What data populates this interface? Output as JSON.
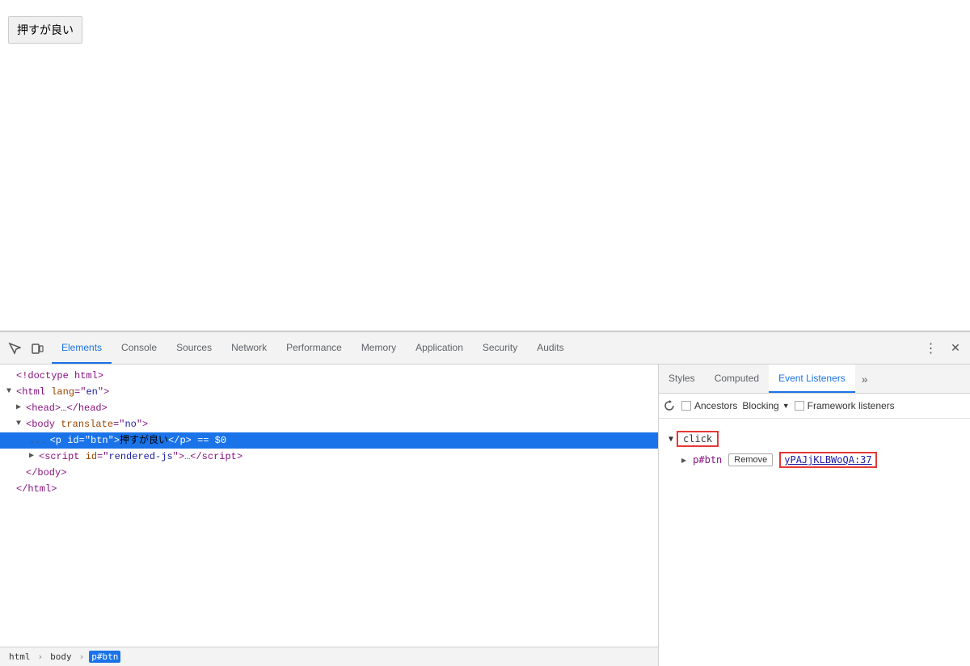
{
  "page": {
    "button_label": "押すが良い"
  },
  "devtools": {
    "tabs": [
      {
        "id": "elements",
        "label": "Elements",
        "active": true
      },
      {
        "id": "console",
        "label": "Console",
        "active": false
      },
      {
        "id": "sources",
        "label": "Sources",
        "active": false
      },
      {
        "id": "network",
        "label": "Network",
        "active": false
      },
      {
        "id": "performance",
        "label": "Performance",
        "active": false
      },
      {
        "id": "memory",
        "label": "Memory",
        "active": false
      },
      {
        "id": "application",
        "label": "Application",
        "active": false
      },
      {
        "id": "security",
        "label": "Security",
        "active": false
      },
      {
        "id": "audits",
        "label": "Audits",
        "active": false
      }
    ],
    "html_lines": [
      {
        "id": "doctype",
        "indent": 0,
        "content": "<!doctype html>"
      },
      {
        "id": "html-open",
        "indent": 0,
        "content": "<html lang=\"en\">"
      },
      {
        "id": "head",
        "indent": 1,
        "content": "<head>…</head>"
      },
      {
        "id": "body-open",
        "indent": 1,
        "content": "<body translate=\"no\">"
      },
      {
        "id": "p-btn",
        "indent": 2,
        "content": "<p id=\"btn\">押すが良い</p> == $0",
        "selected": true
      },
      {
        "id": "script",
        "indent": 2,
        "content": "<script id=\"rendered-js\">…</script>"
      },
      {
        "id": "body-close",
        "indent": 1,
        "content": "</body>"
      },
      {
        "id": "html-close",
        "indent": 0,
        "content": "</html>"
      }
    ],
    "right_panel": {
      "tabs": [
        {
          "id": "styles",
          "label": "Styles",
          "active": false
        },
        {
          "id": "computed",
          "label": "Computed",
          "active": false
        },
        {
          "id": "event-listeners",
          "label": "Event Listeners",
          "active": true
        }
      ],
      "event_listeners": {
        "refresh_title": "Refresh",
        "ancestors_label": "Ancestors",
        "blocking_label": "Blocking",
        "framework_listeners_label": "Framework listeners",
        "click_event": "click",
        "element": "p#btn",
        "remove_label": "Remove",
        "link": "yPAJjKLBWoQA:37"
      }
    },
    "breadcrumb": [
      {
        "id": "bc-html",
        "label": "html"
      },
      {
        "id": "bc-body",
        "label": "body"
      },
      {
        "id": "bc-p",
        "label": "p#btn",
        "active": true
      }
    ]
  }
}
